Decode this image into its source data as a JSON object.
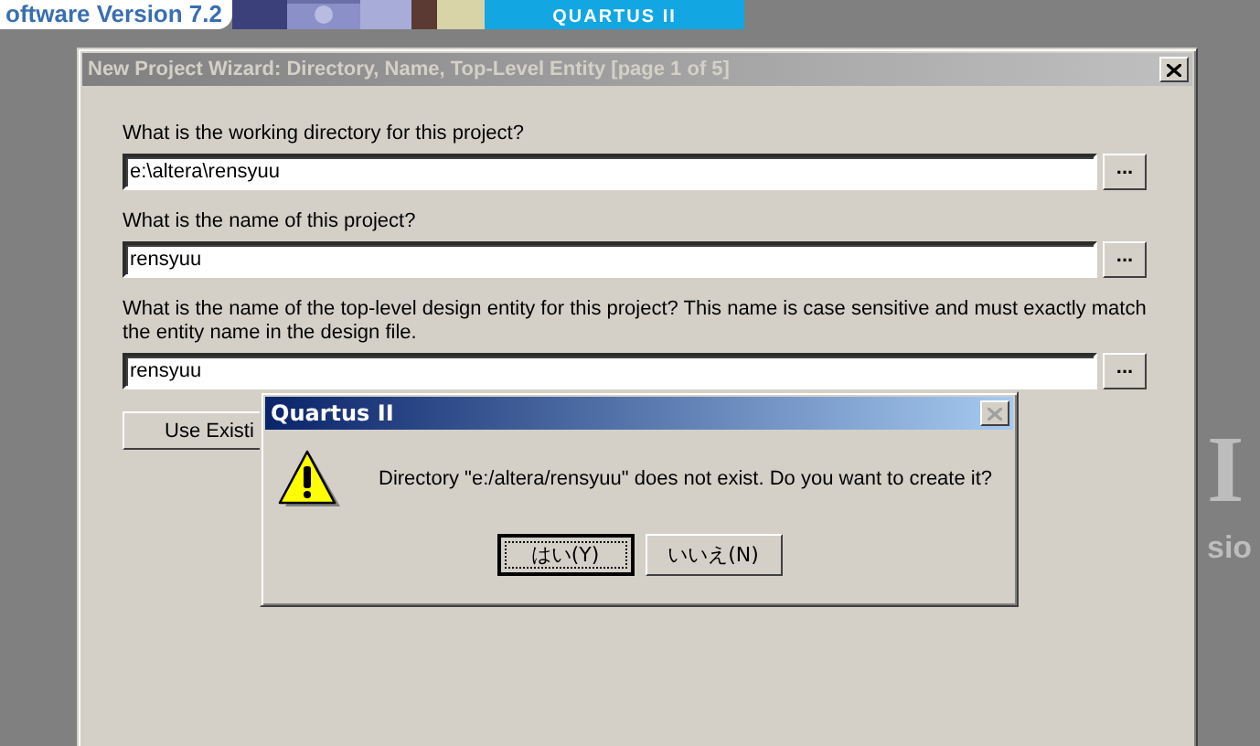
{
  "background": {
    "banner_text": "oftware Version 7.2",
    "logo_text": "QUARTUS II",
    "side_texts": [
      "I",
      "sio"
    ]
  },
  "wizard": {
    "title": "New Project Wizard: Directory, Name, Top-Level Entity [page 1 of 5]",
    "active": false,
    "fields": [
      {
        "label": "What is the working directory for this project?",
        "value": "e:\\altera\\rensyuu",
        "browse": "..."
      },
      {
        "label": "What is the name of this project?",
        "value": "rensyuu",
        "browse": "..."
      },
      {
        "label": "What is the name of the top-level design entity for this project? This name is case sensitive and must exactly match the entity name in the design file.",
        "value": "rensyuu",
        "browse": "..."
      }
    ],
    "buttons": [
      "Use Existi"
    ]
  },
  "dialog": {
    "title": "Quartus II",
    "active": true,
    "close_disabled": true,
    "message": "Directory \"e:/altera/rensyuu\" does not exist. Do you want to create it?",
    "buttons": [
      {
        "label": "はい(Y)",
        "default": true
      },
      {
        "label": "いいえ(N)",
        "default": false
      }
    ]
  }
}
